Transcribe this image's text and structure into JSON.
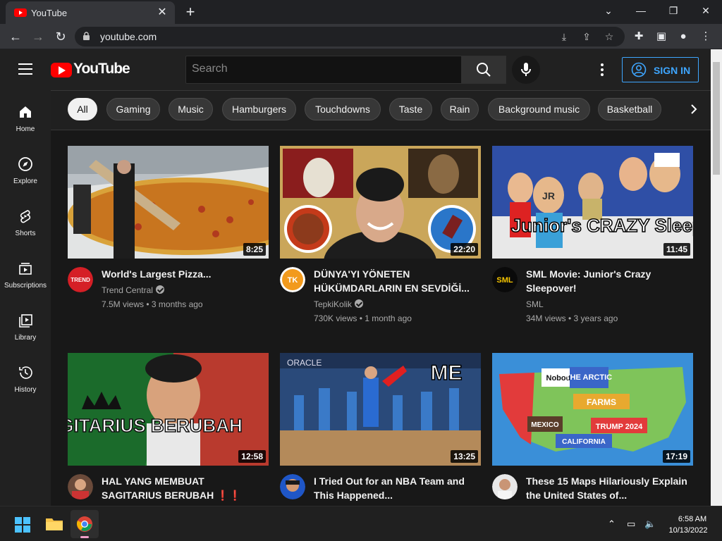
{
  "browser": {
    "tab_title": "YouTube",
    "url": "youtube.com"
  },
  "masthead": {
    "logo_text": "YouTube",
    "search_placeholder": "Search",
    "signin_label": "SIGN IN"
  },
  "sidebar": {
    "items": [
      {
        "label": "Home",
        "icon": "home-icon"
      },
      {
        "label": "Explore",
        "icon": "compass-icon"
      },
      {
        "label": "Shorts",
        "icon": "shorts-icon"
      },
      {
        "label": "Subscriptions",
        "icon": "subscriptions-icon"
      },
      {
        "label": "Library",
        "icon": "library-icon"
      },
      {
        "label": "History",
        "icon": "history-icon"
      }
    ]
  },
  "chips": [
    "All",
    "Gaming",
    "Music",
    "Hamburgers",
    "Touchdowns",
    "Taste",
    "Rain",
    "Background music",
    "Basketball"
  ],
  "videos": [
    {
      "title": "World's Largest Pizza...",
      "channel": "Trend Central",
      "verified": true,
      "meta": "7.5M views • 3 months ago",
      "duration": "8:25"
    },
    {
      "title": "DÜNYA'YI YÖNETEN HÜKÜMDARLARIN EN SEVDİĞİ...",
      "channel": "TepkiKolik",
      "verified": true,
      "meta": "730K views • 1 month ago",
      "duration": "22:20"
    },
    {
      "title": "SML Movie: Junior's Crazy Sleepover!",
      "channel": "SML",
      "verified": false,
      "meta": "34M views • 3 years ago",
      "duration": "11:45"
    },
    {
      "title": "HAL YANG MEMBUAT SAGITARIUS BERUBAH ❗❗",
      "channel": "",
      "verified": false,
      "meta": "",
      "duration": "12:58"
    },
    {
      "title": "I Tried Out for an NBA Team and This Happened...",
      "channel": "",
      "verified": false,
      "meta": "",
      "duration": "13:25"
    },
    {
      "title": "These 15 Maps Hilariously Explain the United States of...",
      "channel": "",
      "verified": false,
      "meta": "",
      "duration": "17:19"
    }
  ],
  "thumb_text": {
    "v1": "",
    "v3": "Junior's CRAZY Sleepover!",
    "v3_badge": "JR",
    "v4": "SAGITARIUS BERUBAH",
    "v5_me": "ME",
    "v5_oracle": "ORACLE",
    "v6_map": [
      "Nobody",
      "THE ARCTIC",
      "FARMS",
      "MEXICO",
      "TRUMP 2024",
      "CALIFORNIA"
    ]
  },
  "avatar_text": {
    "v1": "TREND",
    "v2": "TK",
    "v3": "SML"
  },
  "taskbar": {
    "time": "6:58 AM",
    "date": "10/13/2022"
  },
  "colors": {
    "yt_red": "#ff0000",
    "signin_blue": "#3ea6ff",
    "background": "#181818"
  }
}
